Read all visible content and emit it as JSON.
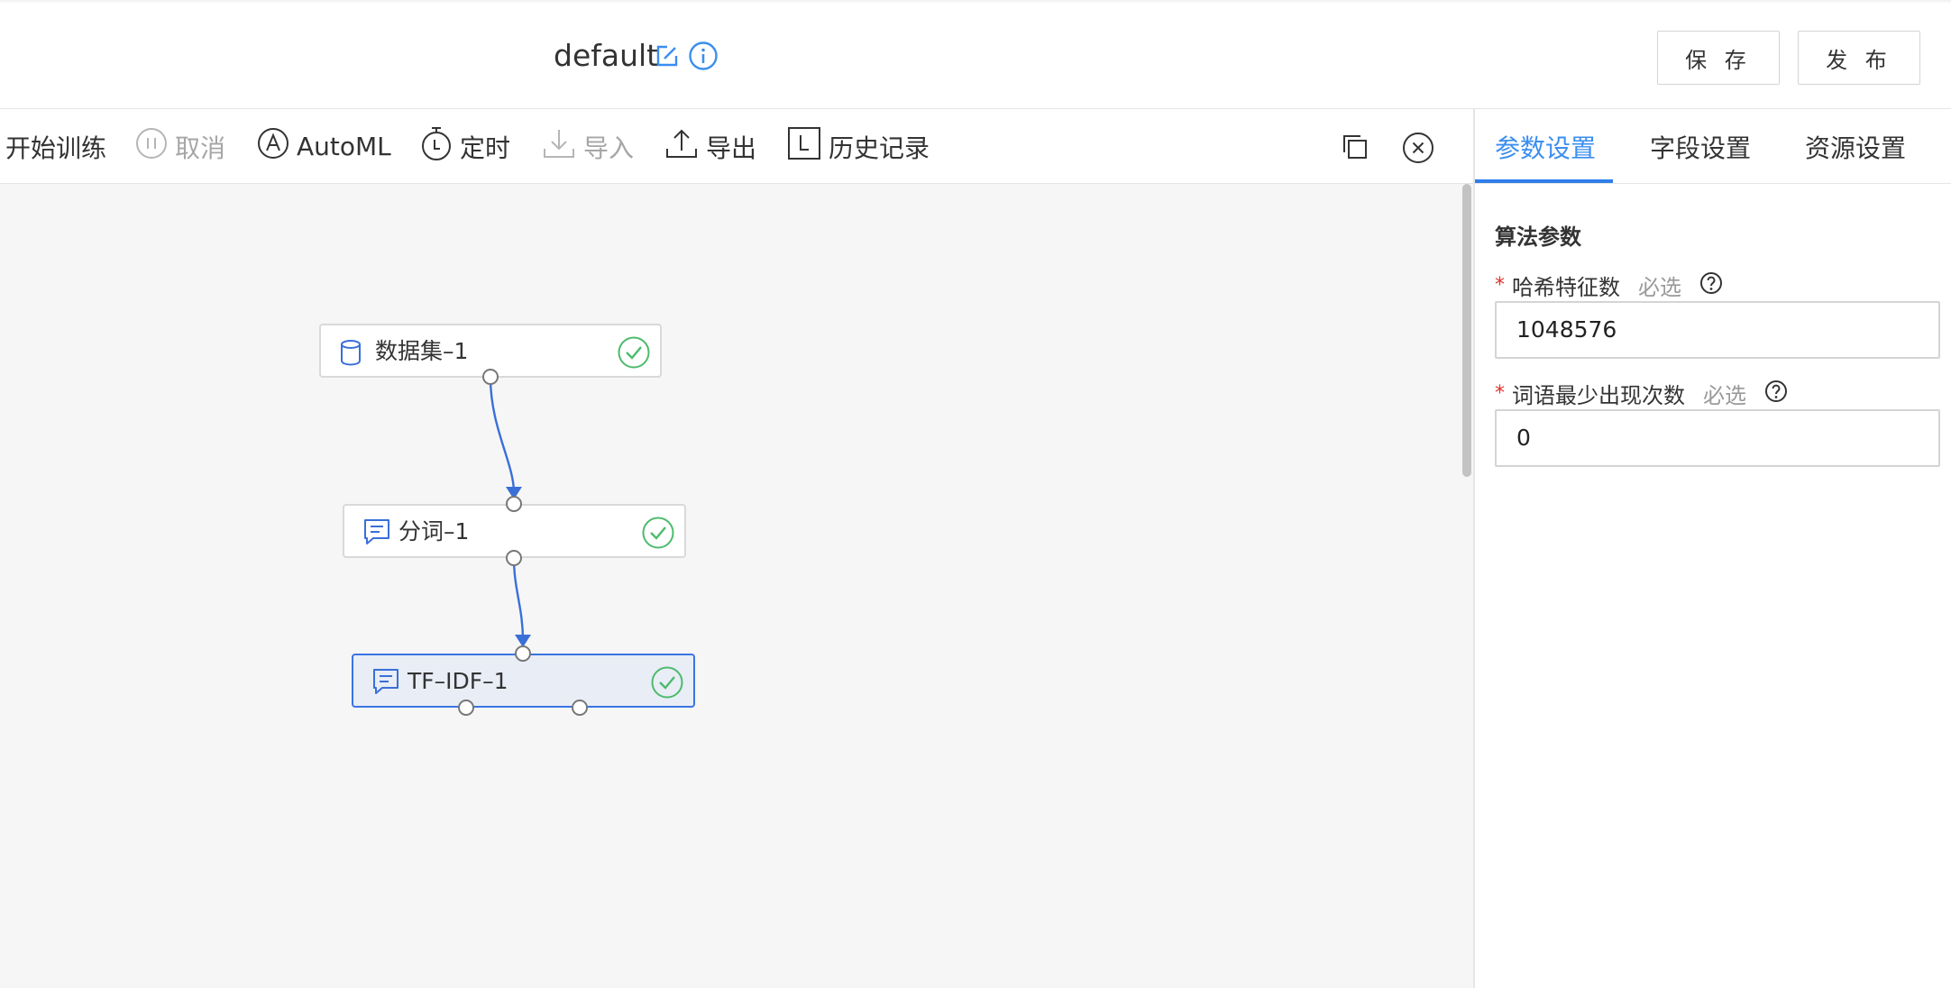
{
  "header": {
    "title": "default",
    "save_label": "保 存",
    "publish_label": "发 布"
  },
  "toolbar": {
    "items": [
      {
        "label": "开始训练",
        "icon": "play-icon",
        "enabled": true
      },
      {
        "label": "取消",
        "icon": "pause-icon",
        "enabled": false
      },
      {
        "label": "AutoML",
        "icon": "automl-icon",
        "enabled": true
      },
      {
        "label": "定时",
        "icon": "timer-icon",
        "enabled": true
      },
      {
        "label": "导入",
        "icon": "import-icon",
        "enabled": false
      },
      {
        "label": "导出",
        "icon": "export-icon",
        "enabled": true
      },
      {
        "label": "历史记录",
        "icon": "history-icon",
        "enabled": true
      }
    ]
  },
  "canvas": {
    "nodes": [
      {
        "label": "数据集–1",
        "icon": "database-icon",
        "status": "success",
        "selected": false
      },
      {
        "label": "分词–1",
        "icon": "text-component-icon",
        "status": "success",
        "selected": false
      },
      {
        "label": "TF–IDF–1",
        "icon": "text-component-icon",
        "status": "success",
        "selected": true
      }
    ]
  },
  "panel": {
    "tabs": [
      {
        "label": "参数设置",
        "active": true
      },
      {
        "label": "字段设置",
        "active": false
      },
      {
        "label": "资源设置",
        "active": false
      }
    ],
    "section_title": "算法参数",
    "fields": [
      {
        "required_mark": "*",
        "label": "哈希特征数",
        "hint": "必选",
        "value": "1048576"
      },
      {
        "required_mark": "*",
        "label": "词语最少出现次数",
        "hint": "必选",
        "value": "0"
      }
    ]
  },
  "colors": {
    "accent": "#3a8ef0",
    "edge": "#3a6fd8",
    "success": "#4cbb6c",
    "required": "#e0312b",
    "canvas_bg": "#f6f6f6"
  }
}
